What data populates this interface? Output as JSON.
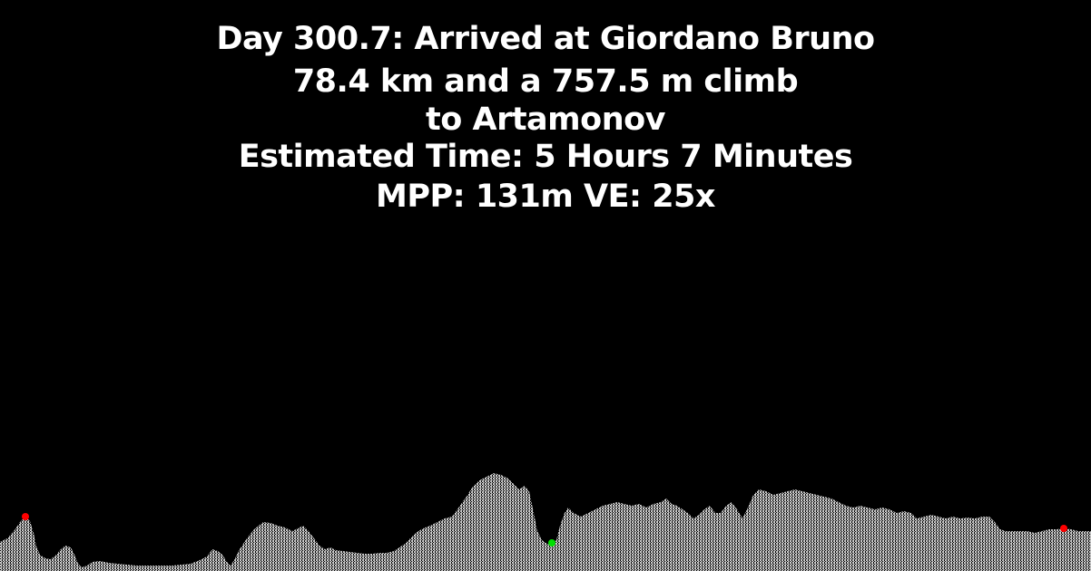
{
  "header": {
    "line1": "Day 300.7: Arrived at Giordano Bruno",
    "line2": "78.4 km and a 757.5 m climb",
    "line3": "to Artamonov",
    "line4": "Estimated Time: 5 Hours 7 Minutes",
    "line5": "MPP: 131m VE: 25x"
  },
  "colors": {
    "background": "#000000",
    "text": "#ffffff",
    "terrain": "#c8c8c8",
    "current_marker": "#00e000",
    "waypoint_marker": "#ff0000"
  },
  "markers": {
    "current": "green-dot",
    "waypoints": "red-dot"
  }
}
